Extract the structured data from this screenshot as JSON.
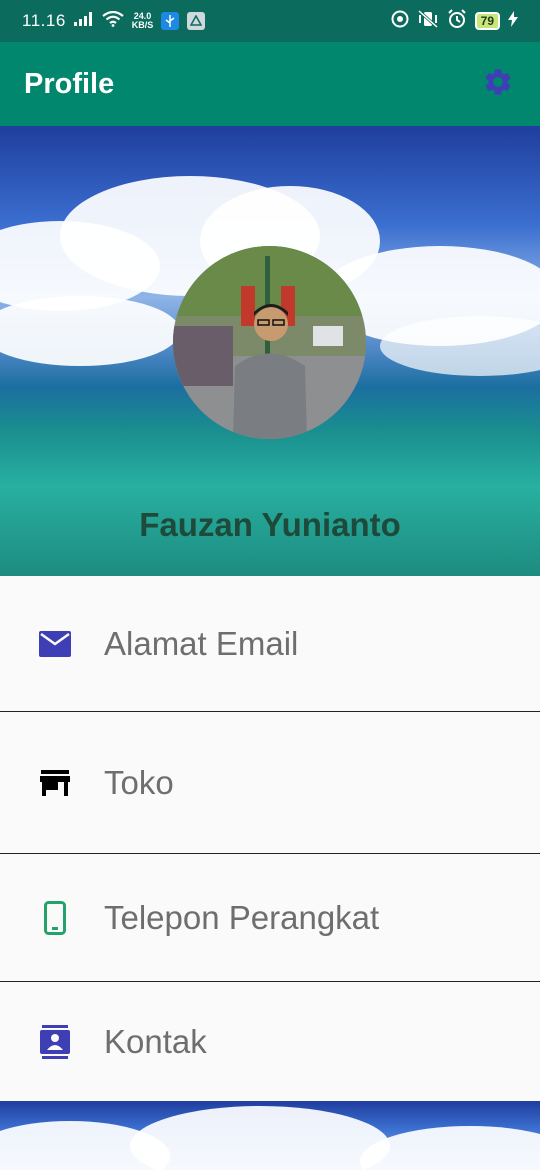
{
  "status_bar": {
    "time": "11.16",
    "net_speed_value": "24.0",
    "net_speed_unit": "KB/S",
    "battery": "79"
  },
  "app_bar": {
    "title": "Profile",
    "settings_icon": "gear-icon"
  },
  "profile": {
    "name": "Fauzan Yunianto"
  },
  "menu": [
    {
      "label": "Alamat Email",
      "icon": "mail-icon",
      "color": "#3f3fb5"
    },
    {
      "label": "Toko",
      "icon": "store-icon",
      "color": "#000000"
    },
    {
      "label": "Telepon Perangkat",
      "icon": "phone-icon",
      "color": "#23a36a"
    },
    {
      "label": "Kontak",
      "icon": "contact-icon",
      "color": "#3f3fb5"
    }
  ],
  "colors": {
    "status_bar": "#0b6b5d",
    "app_bar": "#00876d",
    "accent": "#3f3fb5"
  }
}
